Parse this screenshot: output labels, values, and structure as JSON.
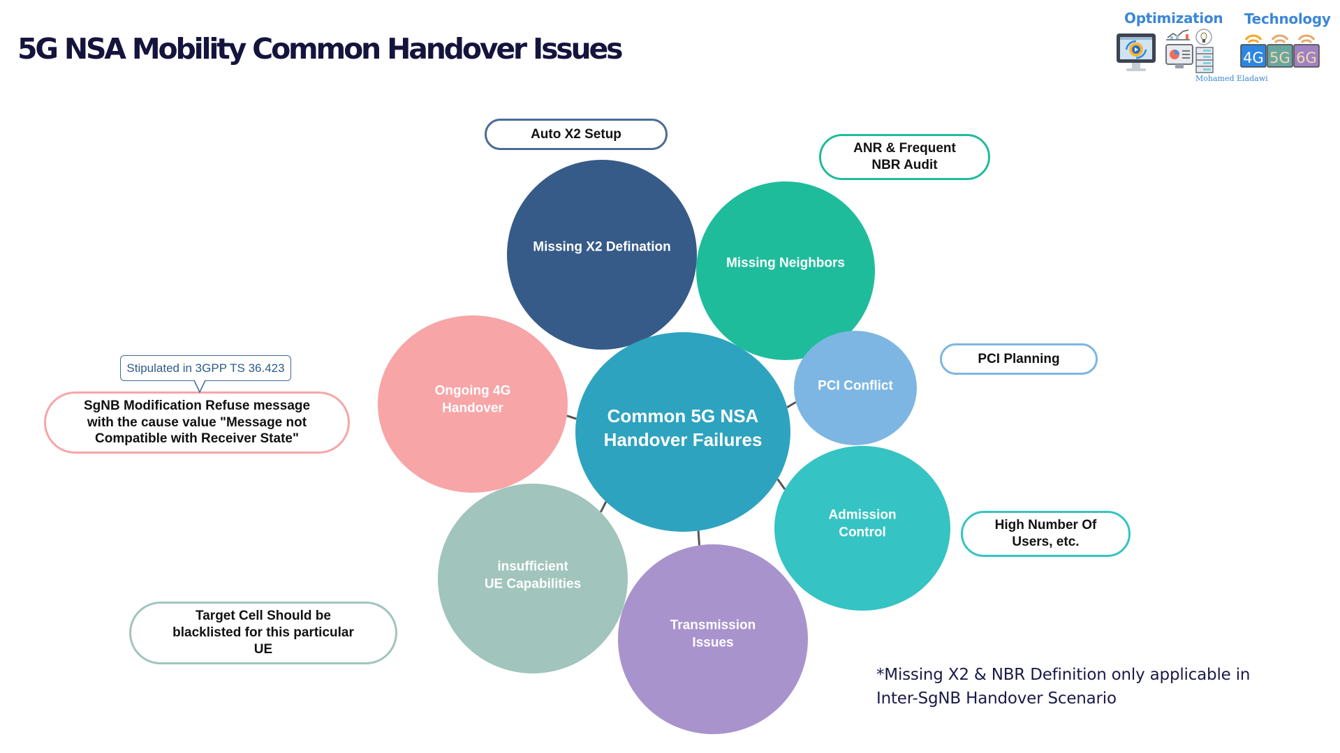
{
  "title": "5G NSA Mobility Common Handover Issues",
  "branding": {
    "optimization_label": "Optimization",
    "technology_label": "Technology",
    "author": "Mohamed Eladawi",
    "icons": [
      "monitor-gear-icon",
      "analytics-chart-icon",
      "lightbulb-icon",
      "dashboard-screen-icon",
      "server-rack-icon",
      "4g-signal-icon",
      "5g-signal-icon",
      "6g-signal-icon"
    ],
    "generation_labels": [
      "4G",
      "5G",
      "6G"
    ],
    "colors": {
      "accent": "#3b87d6",
      "g4": "#2f86e0",
      "g5": "#6aa6a0",
      "g6": "#9f82c2"
    }
  },
  "diagram": {
    "center": {
      "label": "Common 5G NSA\nHandover Failures",
      "color": "#2ea3bf"
    },
    "nodes": [
      {
        "id": "missing-x2",
        "label": "Missing X2 Defination",
        "color": "#375b88",
        "solution": "Auto X2 Setup"
      },
      {
        "id": "missing-neighbors",
        "label": "Missing Neighbors",
        "color": "#1fbc9c",
        "solution": "ANR & Frequent\nNBR Audit"
      },
      {
        "id": "pci-conflict",
        "label": "PCI Conflict",
        "color": "#7db6e3",
        "solution": "PCI Planning"
      },
      {
        "id": "admission-control",
        "label": "Admission\nControl",
        "color": "#35c3c3",
        "solution": "High Number Of\nUsers, etc."
      },
      {
        "id": "transmission-issues",
        "label": "Transmission\nIssues",
        "color": "#a993cd",
        "solution": ""
      },
      {
        "id": "ue-capabilities",
        "label": "insufficient\nUE Capabilities",
        "color": "#a1c4bc",
        "solution": "Target Cell Should be\nblacklisted for this particular\nUE"
      },
      {
        "id": "ongoing-4g-handover",
        "label": "Ongoing 4G\nHandover",
        "color": "#f7a5a7",
        "solution": "SgNB Modification Refuse message\nwith the cause value \"Message not\nCompatible with Receiver State\""
      }
    ],
    "connector_color": "#555555",
    "tooltip": "Stipulated in 3GPP TS 36.423"
  },
  "footnote": "*Missing X2 & NBR Definition only applicable in\nInter-SgNB Handover Scenario"
}
